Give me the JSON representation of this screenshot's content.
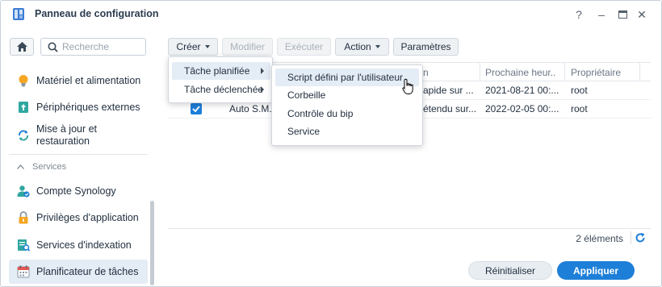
{
  "window": {
    "title": "Panneau de configuration",
    "controls": [
      "?",
      "–",
      "▭",
      "✕"
    ]
  },
  "sidebar": {
    "search_placeholder": "Recherche",
    "items": [
      {
        "label": "Matériel et alimentation",
        "icon": "bulb-icon"
      },
      {
        "label": "Périphériques externes",
        "icon": "external-device-icon"
      },
      {
        "label_line1": "Mise à jour et",
        "label_line2": "restauration",
        "icon": "update-restore-icon"
      }
    ],
    "section_label": "Services",
    "service_items": [
      {
        "label": "Compte Synology",
        "icon": "synology-account-icon"
      },
      {
        "label": "Privilèges d'application",
        "icon": "lock-icon"
      },
      {
        "label": "Services d'indexation",
        "icon": "indexing-icon"
      },
      {
        "label": "Planificateur de tâches",
        "icon": "calendar-icon",
        "active": true
      }
    ]
  },
  "toolbar": {
    "create": "Créer",
    "edit": "Modifier",
    "run": "Exécuter",
    "action": "Action",
    "settings": "Paramètres"
  },
  "grid": {
    "columns": [
      "n",
      "Prochaine heur...",
      "Propriétaire"
    ],
    "rows": [
      {
        "checked": null,
        "task": "",
        "action": "apide sur ...",
        "next_run": "2021-08-21 00:...",
        "owner": "root"
      },
      {
        "checked": true,
        "task": "Auto S.M...",
        "action": "étendu sur...",
        "next_run": "2022-02-05 00:...",
        "owner": "root"
      }
    ],
    "count_label": "2 éléments"
  },
  "footer": {
    "reset": "Réinitialiser",
    "apply": "Appliquer"
  },
  "create_menu": {
    "items": [
      "Tâche planifiée",
      "Tâche déclenchée"
    ]
  },
  "scheduled_submenu": {
    "items": [
      "Script défini par l'utilisateur",
      "Corbeille",
      "Contrôle du bip",
      "Service"
    ]
  },
  "colors": {
    "accent": "#1e7fd8",
    "selected_bg": "#e4ecf5"
  }
}
